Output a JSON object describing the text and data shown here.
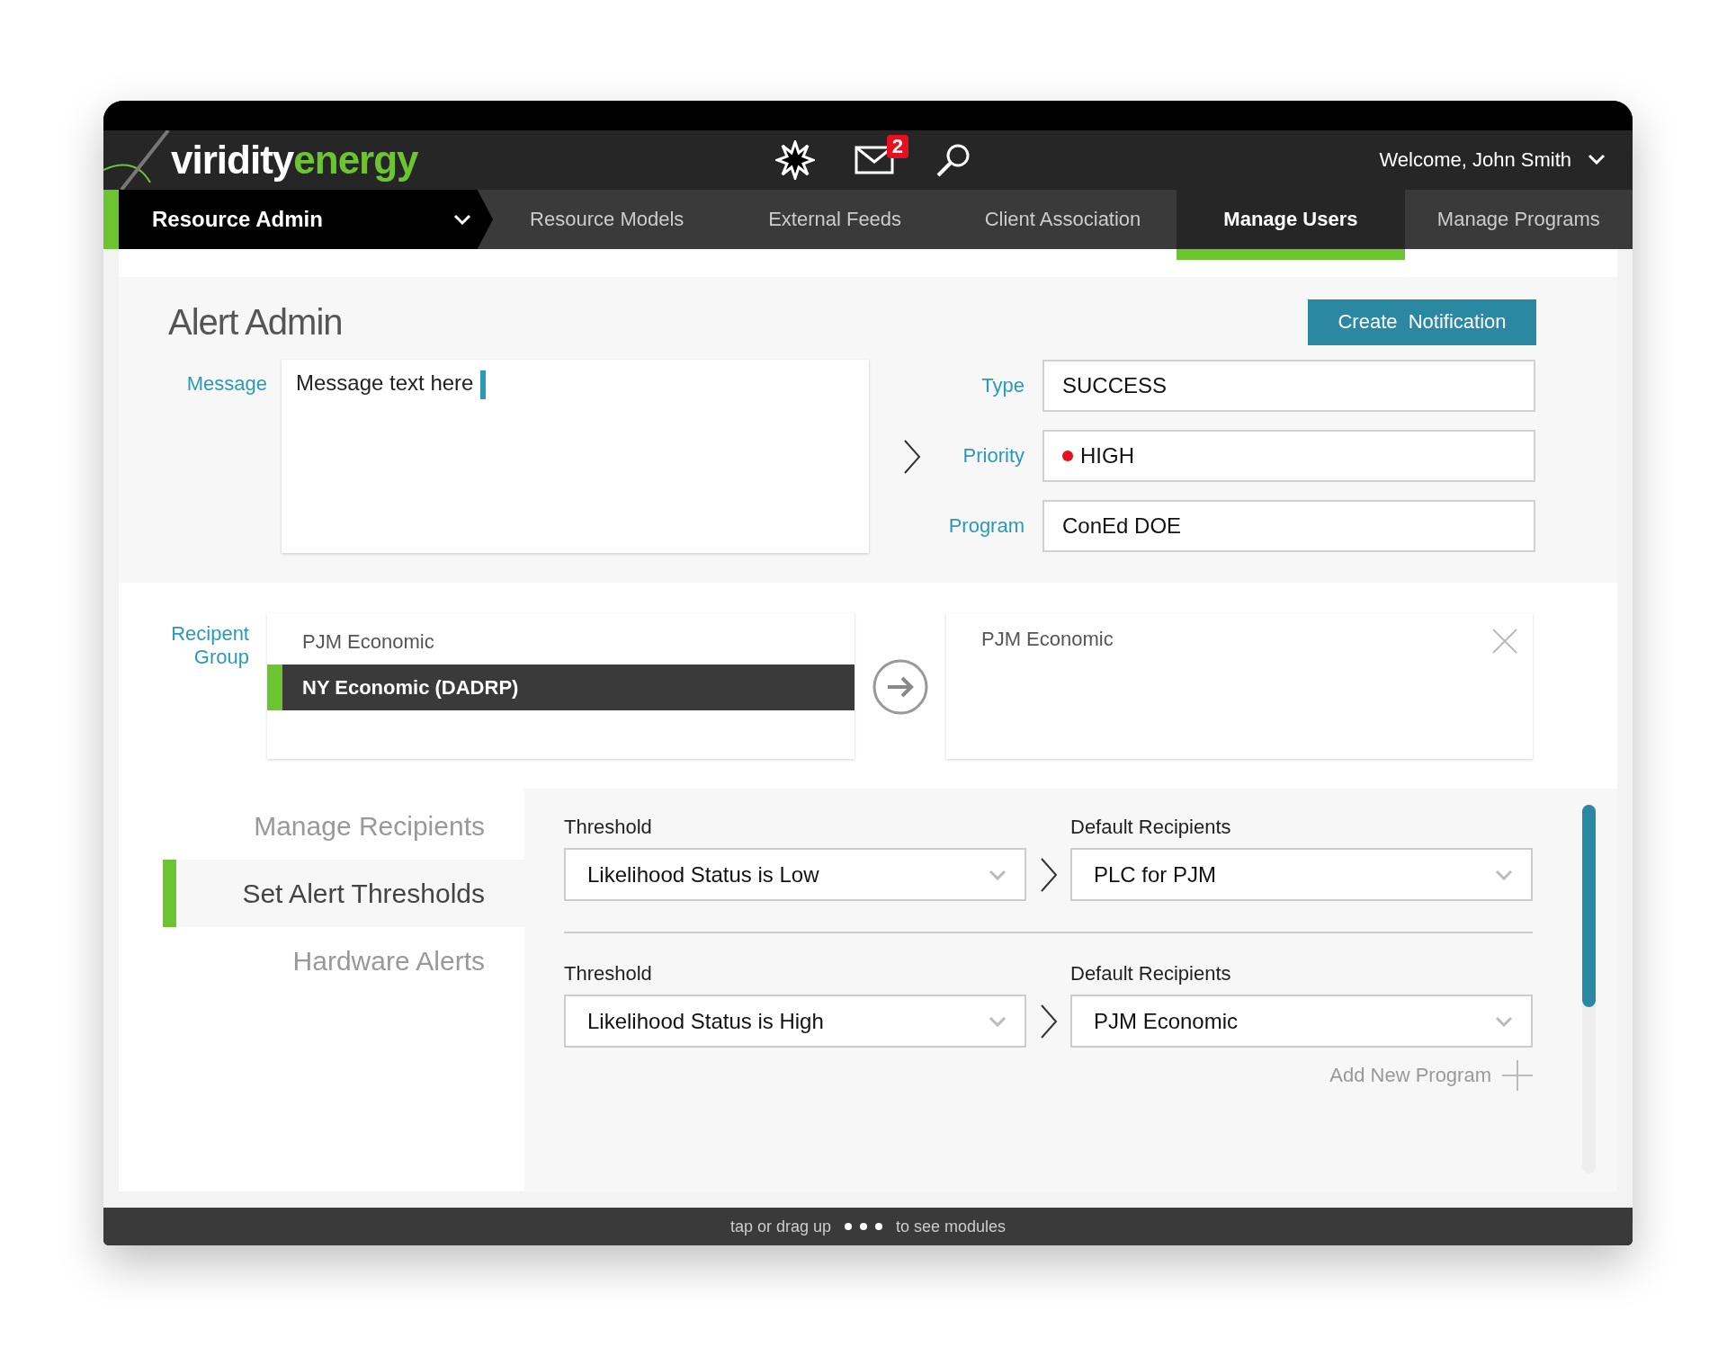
{
  "header": {
    "logo": {
      "first": "viridity",
      "second": "energy"
    },
    "mail_badge": "2",
    "welcome": "Welcome, John Smith"
  },
  "nav": {
    "section": "Resource Admin",
    "tabs": [
      {
        "label": "Resource Models",
        "selected": false
      },
      {
        "label": "External Feeds",
        "selected": false
      },
      {
        "label": "Client Association",
        "selected": false
      },
      {
        "label": "Manage Users",
        "selected": true
      },
      {
        "label": "Manage Programs",
        "selected": false
      }
    ]
  },
  "alert": {
    "title": "Alert Admin",
    "create_button": "Create  Notification",
    "message_label": "Message",
    "message_value": "Message text here",
    "fields": [
      {
        "label": "Type",
        "value": "SUCCESS"
      },
      {
        "label": "Priority",
        "value": "HIGH",
        "color": "#e8101e"
      },
      {
        "label": "Program",
        "value": "ConEd DOE"
      }
    ]
  },
  "recipients": {
    "label_lines": [
      "Recipent",
      "Group"
    ],
    "items": [
      {
        "label": "PJM Economic",
        "selected": false
      },
      {
        "label": "NY Economic (DADRP)",
        "selected": true
      }
    ],
    "chosen": "PJM Economic"
  },
  "sidebar": [
    {
      "label": "Manage Recipients",
      "selected": false
    },
    {
      "label": "Set Alert Thresholds",
      "selected": true
    },
    {
      "label": "Hardware Alerts",
      "selected": false
    }
  ],
  "thresholds": [
    {
      "threshold_label": "Threshold",
      "threshold": "Likelihood Status is Low",
      "recipients_label": "Default Recipients",
      "recipients": "PLC for PJM"
    },
    {
      "threshold_label": "Threshold",
      "threshold": "Likelihood Status is High",
      "recipients_label": "Default Recipients",
      "recipients": "PJM Economic"
    }
  ],
  "add_program": "Add New Program",
  "footer": {
    "before": "tap or drag up",
    "after": "to see modules"
  }
}
